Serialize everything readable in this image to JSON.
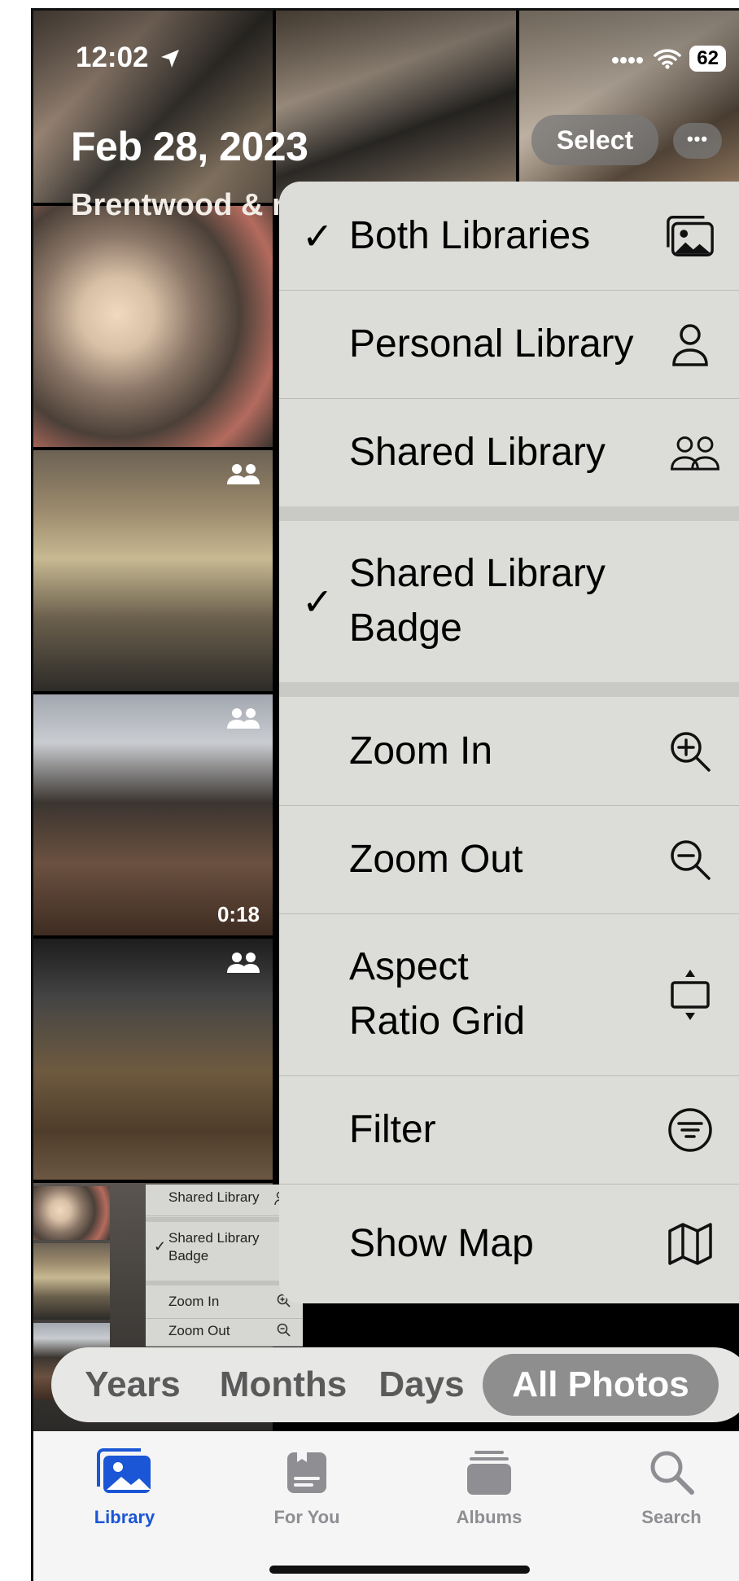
{
  "status_bar": {
    "time": "12:02",
    "battery": "62"
  },
  "header": {
    "date": "Feb 28, 2023",
    "location": "Brentwood & r",
    "select_label": "Select",
    "more_label": "•••"
  },
  "photos": {
    "video_duration": "0:18"
  },
  "menu": {
    "items": [
      {
        "label": "Both Libraries",
        "checked": true,
        "icon": "photo-stack-icon"
      },
      {
        "label": "Personal Library",
        "checked": false,
        "icon": "person-icon"
      },
      {
        "label": "Shared Library",
        "checked": false,
        "icon": "two-people-icon"
      },
      {
        "label_line1": "Shared Library",
        "label_line2": "Badge",
        "checked": true
      },
      {
        "label": "Zoom In",
        "icon": "zoom-in-icon"
      },
      {
        "label": "Zoom Out",
        "icon": "zoom-out-icon"
      },
      {
        "label_line1": "Aspect",
        "label_line2": "Ratio Grid",
        "icon": "aspect-grid-icon"
      },
      {
        "label": "Filter",
        "icon": "filter-icon"
      },
      {
        "label": "Show Map",
        "icon": "map-icon"
      }
    ],
    "checkmark": "✓"
  },
  "mini_menu": {
    "shared_library": "Shared Library",
    "badge_line1": "Shared Library",
    "badge_line2": "Badge",
    "zoom_in": "Zoom In",
    "zoom_out": "Zoom Out",
    "checkmark": "✓"
  },
  "segments": {
    "years": "Years",
    "months": "Months",
    "days": "Days",
    "all_photos": "All Photos",
    "active": "All Photos"
  },
  "tabs": [
    {
      "label": "Library",
      "active": true
    },
    {
      "label": "For You",
      "active": false
    },
    {
      "label": "Albums",
      "active": false
    },
    {
      "label": "Search",
      "active": false
    }
  ],
  "colors": {
    "accent": "#1a56d6",
    "inactive": "#8e8e93",
    "menu_bg": "#dcdcd8"
  }
}
